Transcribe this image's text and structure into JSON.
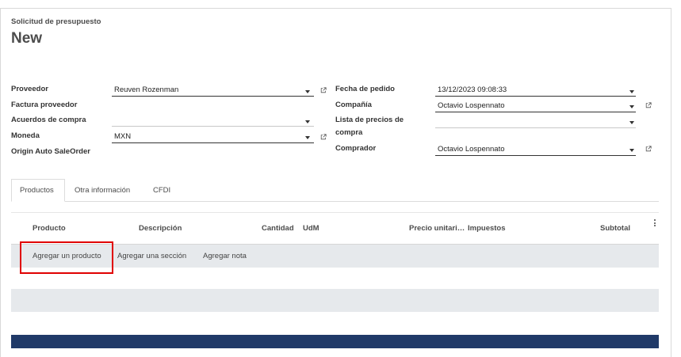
{
  "form": {
    "subtitle": "Solicitud de presupuesto",
    "title": "New"
  },
  "left_fields": {
    "proveedor_label": "Proveedor",
    "proveedor_value": "Reuven Rozenman",
    "factura_label": "Factura proveedor",
    "acuerdos_label": "Acuerdos de compra",
    "moneda_label": "Moneda",
    "moneda_value": "MXN",
    "origin_label": "Origin Auto SaleOrder"
  },
  "right_fields": {
    "fecha_label": "Fecha de pedido",
    "fecha_value": "13/12/2023 09:08:33",
    "compania_label": "Compañía",
    "compania_value": "Octavio Lospennato",
    "lista_label_1": "Lista de precios de",
    "lista_label_2": "compra",
    "comprador_label": "Comprador",
    "comprador_value": "Octavio Lospennato"
  },
  "tabs": [
    "Productos",
    "Otra información",
    "CFDI"
  ],
  "table": {
    "columns": [
      "Producto",
      "Descripción",
      "Cantidad",
      "UdM",
      "Precio unitari…",
      "Impuestos",
      "Subtotal"
    ]
  },
  "actions": {
    "add_product": "Agregar un producto",
    "add_section": "Agregar una sección",
    "add_note": "Agregar nota"
  },
  "icons": {
    "external": "external-link-icon",
    "dropdown": "caret-down-icon",
    "menu": "kebab-menu-icon"
  },
  "colors": {
    "highlight": "#e00000",
    "footer": "#203a68",
    "row_bg": "#e6e9ec"
  }
}
